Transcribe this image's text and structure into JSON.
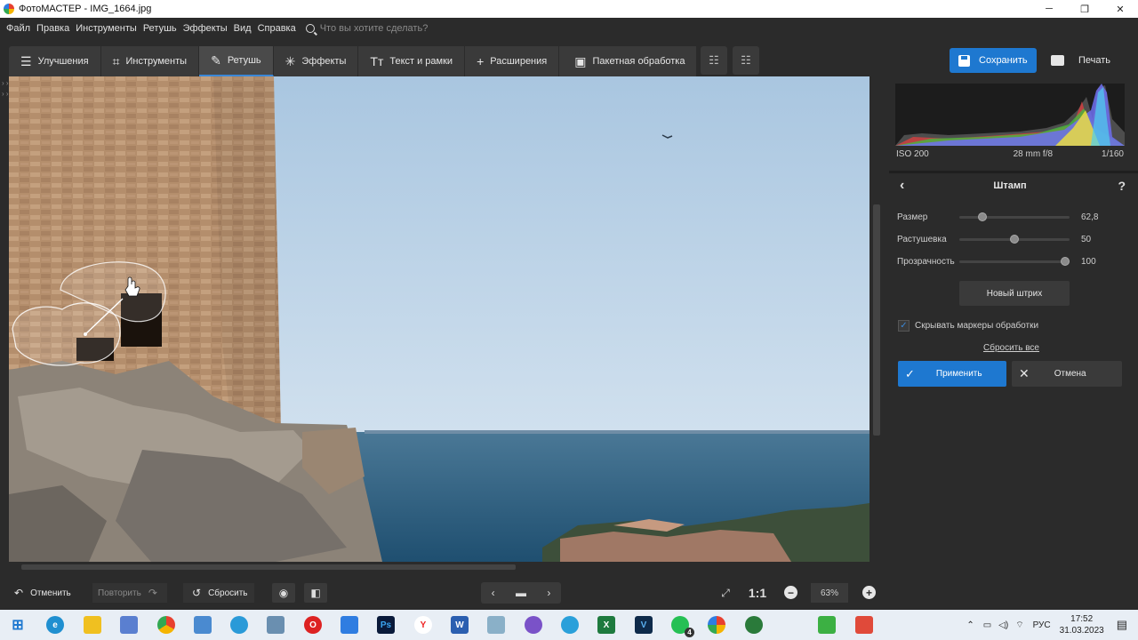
{
  "window": {
    "title": "ФотоМАСТЕР - IMG_1664.jpg",
    "minimize": "─",
    "maximize": "❐",
    "close": "✕"
  },
  "menu": {
    "items": [
      "Файл",
      "Правка",
      "Инструменты",
      "Ретушь",
      "Эффекты",
      "Вид",
      "Справка"
    ],
    "search_placeholder": "Что вы хотите сделать?"
  },
  "toolbar": {
    "tabs": [
      {
        "label": "Улучшения",
        "icon": "sliders-icon",
        "glyph": "☰"
      },
      {
        "label": "Инструменты",
        "icon": "crop-icon",
        "glyph": "⌗"
      },
      {
        "label": "Ретушь",
        "icon": "brush-icon",
        "glyph": "✎",
        "active": true
      },
      {
        "label": "Эффекты",
        "icon": "magic-wand-icon",
        "glyph": "✳"
      },
      {
        "label": "Текст и рамки",
        "icon": "text-icon",
        "glyph": "Tт"
      },
      {
        "label": "Расширения",
        "icon": "plus-icon",
        "glyph": "+"
      }
    ],
    "batch_label": "Пакетная обработка",
    "save_label": "Сохранить",
    "print_label": "Печать"
  },
  "left_strip_arrows": "› › › ›",
  "photo": {
    "sky_color": "#b8d0e6",
    "sea_color": "#2c5a7c",
    "wall_color": "#b08a68"
  },
  "histogram": {
    "iso": "ISO 200",
    "lens": "28 mm f/8",
    "shutter": "1/160"
  },
  "stamp_panel": {
    "title": "Штамп",
    "back": "‹",
    "help": "?",
    "sliders": [
      {
        "label": "Размер",
        "value": "62,8",
        "fraction": 0.18
      },
      {
        "label": "Растушевка",
        "value": "50",
        "fraction": 0.5
      },
      {
        "label": "Прозрачность",
        "value": "100",
        "fraction": 1.0
      }
    ],
    "new_stroke": "Новый штрих",
    "hide_markers_label": "Скрывать маркеры обработки",
    "hide_markers_checked": true,
    "reset_all": "Сбросить все",
    "apply": "Применить",
    "cancel": "Отмена"
  },
  "bottom": {
    "undo": "Отменить",
    "redo": "Повторить",
    "reset": "Сбросить",
    "one_to_one": "1:1",
    "zoom": "63%"
  },
  "taskbar": {
    "language": "РУС",
    "time": "17:52",
    "date": "31.03.2023",
    "whatsapp_badge": "4"
  }
}
